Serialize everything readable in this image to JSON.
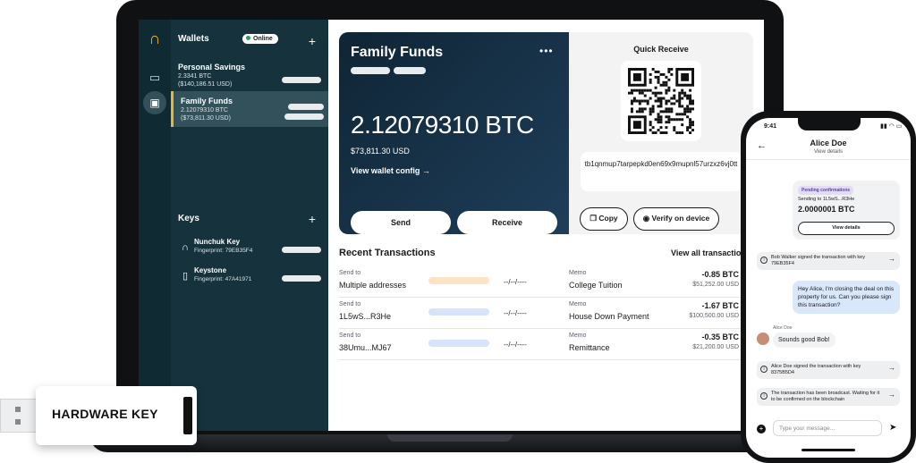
{
  "sidebar": {
    "wallets_title": "Wallets",
    "online_label": "Online",
    "wallets": [
      {
        "name": "Personal Savings",
        "btc": "2.3341 BTC",
        "usd": "($140,186.51 USD)"
      },
      {
        "name": "Family Funds",
        "btc": "2.12079310 BTC",
        "usd": "($73,811.30 USD)"
      }
    ],
    "keys_title": "Keys",
    "keys": [
      {
        "name": "Nunchuk Key",
        "fingerprint": "Fingerprint: 79EB35F4"
      },
      {
        "name": "Keystone",
        "fingerprint": "Fingerprint: 47A41971"
      }
    ]
  },
  "hero": {
    "title": "Family Funds",
    "balance_btc": "2.12079310 BTC",
    "balance_usd": "$73,811.30 USD",
    "config_link": "View wallet config",
    "send_label": "Send",
    "receive_label": "Receive"
  },
  "quick_receive": {
    "title": "Quick Receive",
    "address": "tb1qnmup7tarpepkd0en69x9mupnl57urzxz6vj0tt",
    "copy_label": "Copy",
    "verify_label": "Verify on device"
  },
  "transactions": {
    "title": "Recent Transactions",
    "view_all": "View all transactions",
    "rows": [
      {
        "to_label": "Send to",
        "to": "Multiple addresses",
        "date": "--/--/----",
        "memo_label": "Memo",
        "memo": "College Tuition",
        "amount": "-0.85 BTC",
        "usd": "$51,252.00 USD",
        "bar_color": "#fde3c4"
      },
      {
        "to_label": "Send to",
        "to": "1L5wS...R3He",
        "date": "--/--/----",
        "memo_label": "Memo",
        "memo": "House Down Payment",
        "amount": "-1.67 BTC",
        "usd": "$100,500.00 USD",
        "bar_color": "#d6e4fa"
      },
      {
        "to_label": "Send to",
        "to": "38Umu...MJ67",
        "date": "--/--/----",
        "memo_label": "Memo",
        "memo": "Remittance",
        "amount": "-0.35 BTC",
        "usd": "$21,200.00 USD",
        "bar_color": "#d6e4fa"
      }
    ]
  },
  "hardware_key": {
    "label": "HARDWARE KEY"
  },
  "phone": {
    "time": "9:41",
    "contact": "Alice Doe",
    "view_details": "View details",
    "card": {
      "badge": "Pending confirmations",
      "sending_to": "Sending to 1L5wS...R3He",
      "amount": "2.0000001 BTC",
      "button": "View details"
    },
    "sys1": "Bob Walker signed the transaction with key 79EB35F4",
    "outgoing": "Hey Alice, I'm closing the deal on this property for us. Can you please sign this transaction?",
    "incoming_name": "Alice Doe",
    "incoming": "Sounds good Bob!",
    "sys2": "Alice Doe signed the transaction with key 8375B5D4",
    "sys3": "The transaction has been broadcast. Waiting for it to be confirmed on the blockchain",
    "input_placeholder": "Type your message..."
  },
  "icons": {
    "logo": "nunchuk-logo-icon",
    "chat": "chat-icon",
    "wallet": "wallet-icon",
    "key_headset": "hardware-key-icon",
    "keystone": "keystone-device-icon",
    "more": "more-dots-icon",
    "copy": "copy-icon",
    "eye": "eye-icon",
    "arrow": "arrow-right-icon",
    "back": "back-arrow-icon",
    "send": "send-icon",
    "info": "info-icon"
  },
  "colors": {
    "accent": "#e7b73b",
    "sidebar": "#16333d",
    "hero_start": "#0f2535",
    "hero_end": "#1f3e5a"
  }
}
